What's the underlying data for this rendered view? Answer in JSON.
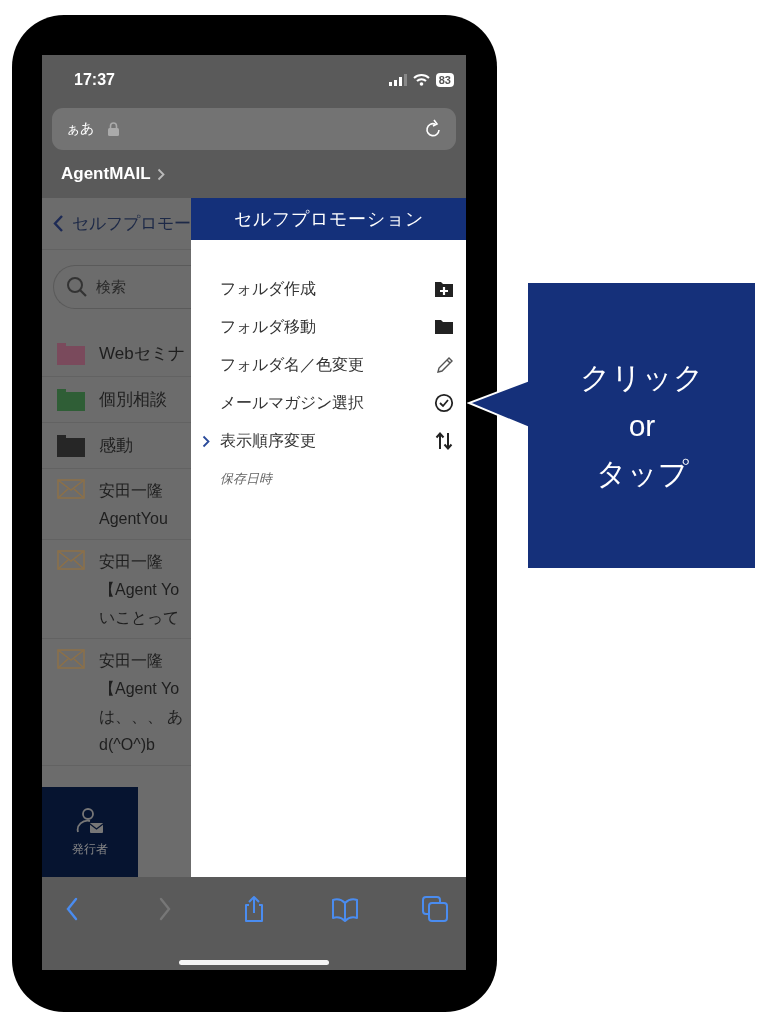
{
  "status_bar": {
    "time": "17:37",
    "battery": "83"
  },
  "address_bar": {
    "text": "ぁあ"
  },
  "site_title": "AgentMAIL",
  "app": {
    "back_label": "セルフプロモー",
    "search": {
      "placeholder": "検索"
    },
    "folders": [
      {
        "name": "Webセミナ",
        "color": "#7a4a5c"
      },
      {
        "name": "個別相談",
        "color": "#2f5e36"
      },
      {
        "name": "感動",
        "color": "#262626"
      }
    ],
    "messages": [
      {
        "sender": "安田一隆",
        "lines": [
          "AgentYou"
        ]
      },
      {
        "sender": "安田一隆",
        "lines": [
          "【Agent Yo",
          "いことって"
        ]
      },
      {
        "sender": "安田一隆",
        "lines": [
          "【Agent Yo",
          "は、、、 あ",
          "d(^O^)b"
        ]
      }
    ],
    "tab_bar": [
      {
        "label": "発行者"
      }
    ]
  },
  "menu": {
    "title": "セルフプロモーション",
    "items": [
      {
        "label": "フォルダ作成",
        "kind": "folder-add",
        "selected": false
      },
      {
        "label": "フォルダ移動",
        "kind": "folder",
        "selected": false
      },
      {
        "label": "フォルダ名／色変更",
        "kind": "pencil",
        "selected": false
      },
      {
        "label": "メールマガジン選択",
        "kind": "check",
        "selected": false
      },
      {
        "label": "表示順序変更",
        "kind": "sort",
        "selected": true
      }
    ],
    "caption": "保存日時"
  },
  "browser_toolbar": [
    {
      "kind": "back",
      "disabled": false
    },
    {
      "kind": "forward",
      "disabled": true
    },
    {
      "kind": "share",
      "disabled": false
    },
    {
      "kind": "bookmarks",
      "disabled": false
    },
    {
      "kind": "tabs",
      "disabled": false
    }
  ],
  "callout": {
    "lines": [
      "クリック",
      "or",
      "タップ"
    ]
  }
}
